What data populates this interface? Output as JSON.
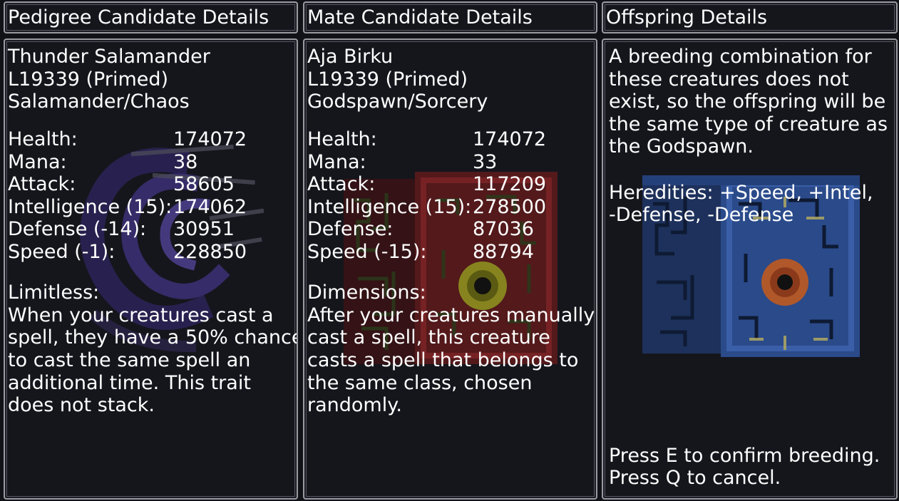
{
  "panels": {
    "pedigree": {
      "title": "Pedigree Candidate Details",
      "name": "Thunder Salamander",
      "level": "L19339 (Primed)",
      "types": "Salamander/Chaos",
      "stats": [
        {
          "label": "Health:",
          "value": "174072"
        },
        {
          "label": "Mana:",
          "value": "38"
        },
        {
          "label": "Attack:",
          "value": "58605"
        },
        {
          "label": "Intelligence (15):",
          "value": "174062"
        },
        {
          "label": "Defense (-14):",
          "value": "30951"
        },
        {
          "label": "Speed (-1):",
          "value": "228850"
        }
      ],
      "trait_name": "Limitless:",
      "trait_lines": [
        "When your creatures cast a",
        "spell, they have a 50% chance",
        "to cast the same spell an",
        "additional time. This trait",
        "does not stack."
      ],
      "art": "swirl-creature-icon"
    },
    "mate": {
      "title": "Mate Candidate Details",
      "name": "Aja Birku",
      "level": "L19339 (Primed)",
      "types": "Godspawn/Sorcery",
      "stats": [
        {
          "label": "Health:",
          "value": "174072"
        },
        {
          "label": "Mana:",
          "value": "33"
        },
        {
          "label": "Attack:",
          "value": "117209"
        },
        {
          "label": "Intelligence (15):",
          "value": "278500"
        },
        {
          "label": "Defense:",
          "value": "87036"
        },
        {
          "label": "Speed (-15):",
          "value": "88794"
        }
      ],
      "trait_name": "Dimensions:",
      "trait_lines": [
        "After your creatures manually",
        "cast a spell, this creature",
        "casts a spell that belongs to",
        "the same class, chosen",
        "randomly."
      ],
      "art": "red-eye-cube-icon",
      "art_color": "#8a1f1f"
    },
    "offspring": {
      "title": "Offspring Details",
      "desc_lines": [
        "A breeding combination for",
        "these creatures does not",
        "exist, so the offspring will be",
        "the same type of creature as",
        "the Godspawn."
      ],
      "heredities_lines": [
        "Heredities: +Speed, +Intel,",
        "-Defense, -Defense"
      ],
      "confirm": "Press E to confirm breeding.",
      "cancel": "Press Q to cancel.",
      "art": "blue-eye-cube-icon",
      "art_color": "#2a4a8a"
    }
  },
  "colors": {
    "panel_bg": "#15161c",
    "border": "#9a9aa2",
    "text": "#ffffff"
  }
}
